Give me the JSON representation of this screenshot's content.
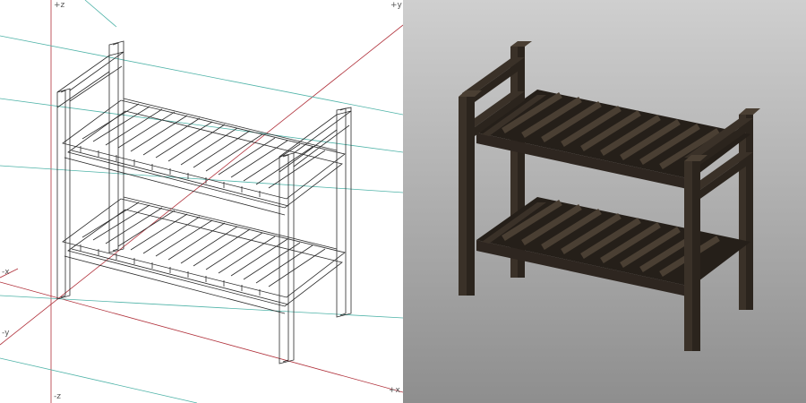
{
  "wireframe_view": {
    "axis_labels": {
      "z_pos": "+z",
      "y_pos": "+y",
      "x_neg": "-x",
      "y_neg": "-y",
      "z_neg": "-z",
      "x_pos": "+x"
    }
  },
  "render_view": {},
  "colors": {
    "wire_line": "#2a2a2a",
    "axis_red": "#b0303a",
    "axis_cyan": "#4fb3a8",
    "wood_dark": "#2b241d",
    "wood_mid": "#3a3128",
    "wood_light": "#4a3f33",
    "render_bg_top": "#cfcfcf",
    "render_bg_bottom": "#8e8e8e"
  }
}
